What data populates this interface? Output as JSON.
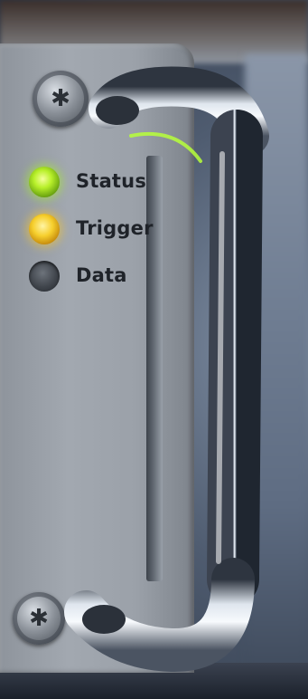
{
  "leds": [
    {
      "label": "Status",
      "state": "on",
      "color": "#b8f02a"
    },
    {
      "label": "Trigger",
      "state": "on",
      "color": "#f6cf2d"
    },
    {
      "label": "Data",
      "state": "off",
      "color": "#40454c"
    }
  ],
  "icons": {
    "screw_top": "torx-screw-icon",
    "screw_bottom": "torx-screw-icon",
    "handle": "chrome-handle"
  },
  "colors": {
    "panel": "#9ba1a9",
    "handle_chrome": "#cfd6df"
  }
}
